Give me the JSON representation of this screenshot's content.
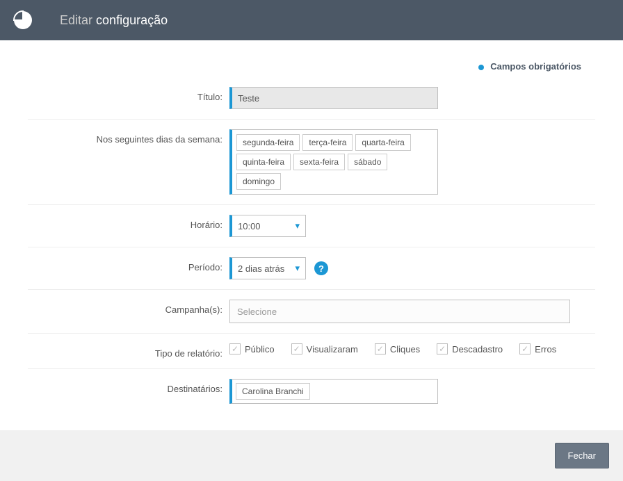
{
  "header": {
    "title_prefix": "Editar",
    "title_bold": "configuração"
  },
  "legend": {
    "required": "Campos obrigatórios"
  },
  "labels": {
    "titulo": "Título:",
    "dias": "Nos seguintes dias da semana:",
    "horario": "Horário:",
    "periodo": "Período:",
    "campanhas": "Campanha(s):",
    "tipo_relatorio": "Tipo de relatório:",
    "destinatarios": "Destinatários:"
  },
  "values": {
    "titulo": "Teste",
    "horario": "10:00",
    "periodo": "2 dias atrás",
    "campanha_placeholder": "Selecione"
  },
  "days": [
    "segunda-feira",
    "terça-feira",
    "quarta-feira",
    "quinta-feira",
    "sexta-feira",
    "sábado",
    "domingo"
  ],
  "report_types": [
    "Público",
    "Visualizaram",
    "Cliques",
    "Descadastro",
    "Erros"
  ],
  "recipients": [
    "Carolina Branchi"
  ],
  "footer": {
    "close": "Fechar"
  }
}
